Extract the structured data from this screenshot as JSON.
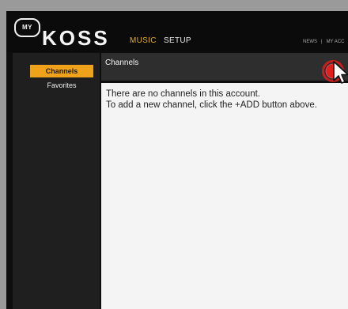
{
  "logo": {
    "badge": "MY",
    "text": "KOSS"
  },
  "nav": {
    "music": "MUSIC",
    "setup": "SETUP"
  },
  "toplinks": {
    "news": "NEWS",
    "separator": "|",
    "account": "MY ACC"
  },
  "sidebar": {
    "items": [
      {
        "label": "Channels",
        "active": true
      },
      {
        "label": "Favorites",
        "active": false
      }
    ]
  },
  "panel": {
    "title": "Channels",
    "message_line1": "There are no channels in this account.",
    "message_line2": "To add a new channel, click the +ADD button above."
  },
  "colors": {
    "accent": "#f0a21a",
    "nav_active": "#e4ab1f",
    "highlight_ring": "#e01b1b"
  },
  "icons": {
    "add_button": "add-circle-icon",
    "cursor": "mouse-pointer-icon"
  }
}
